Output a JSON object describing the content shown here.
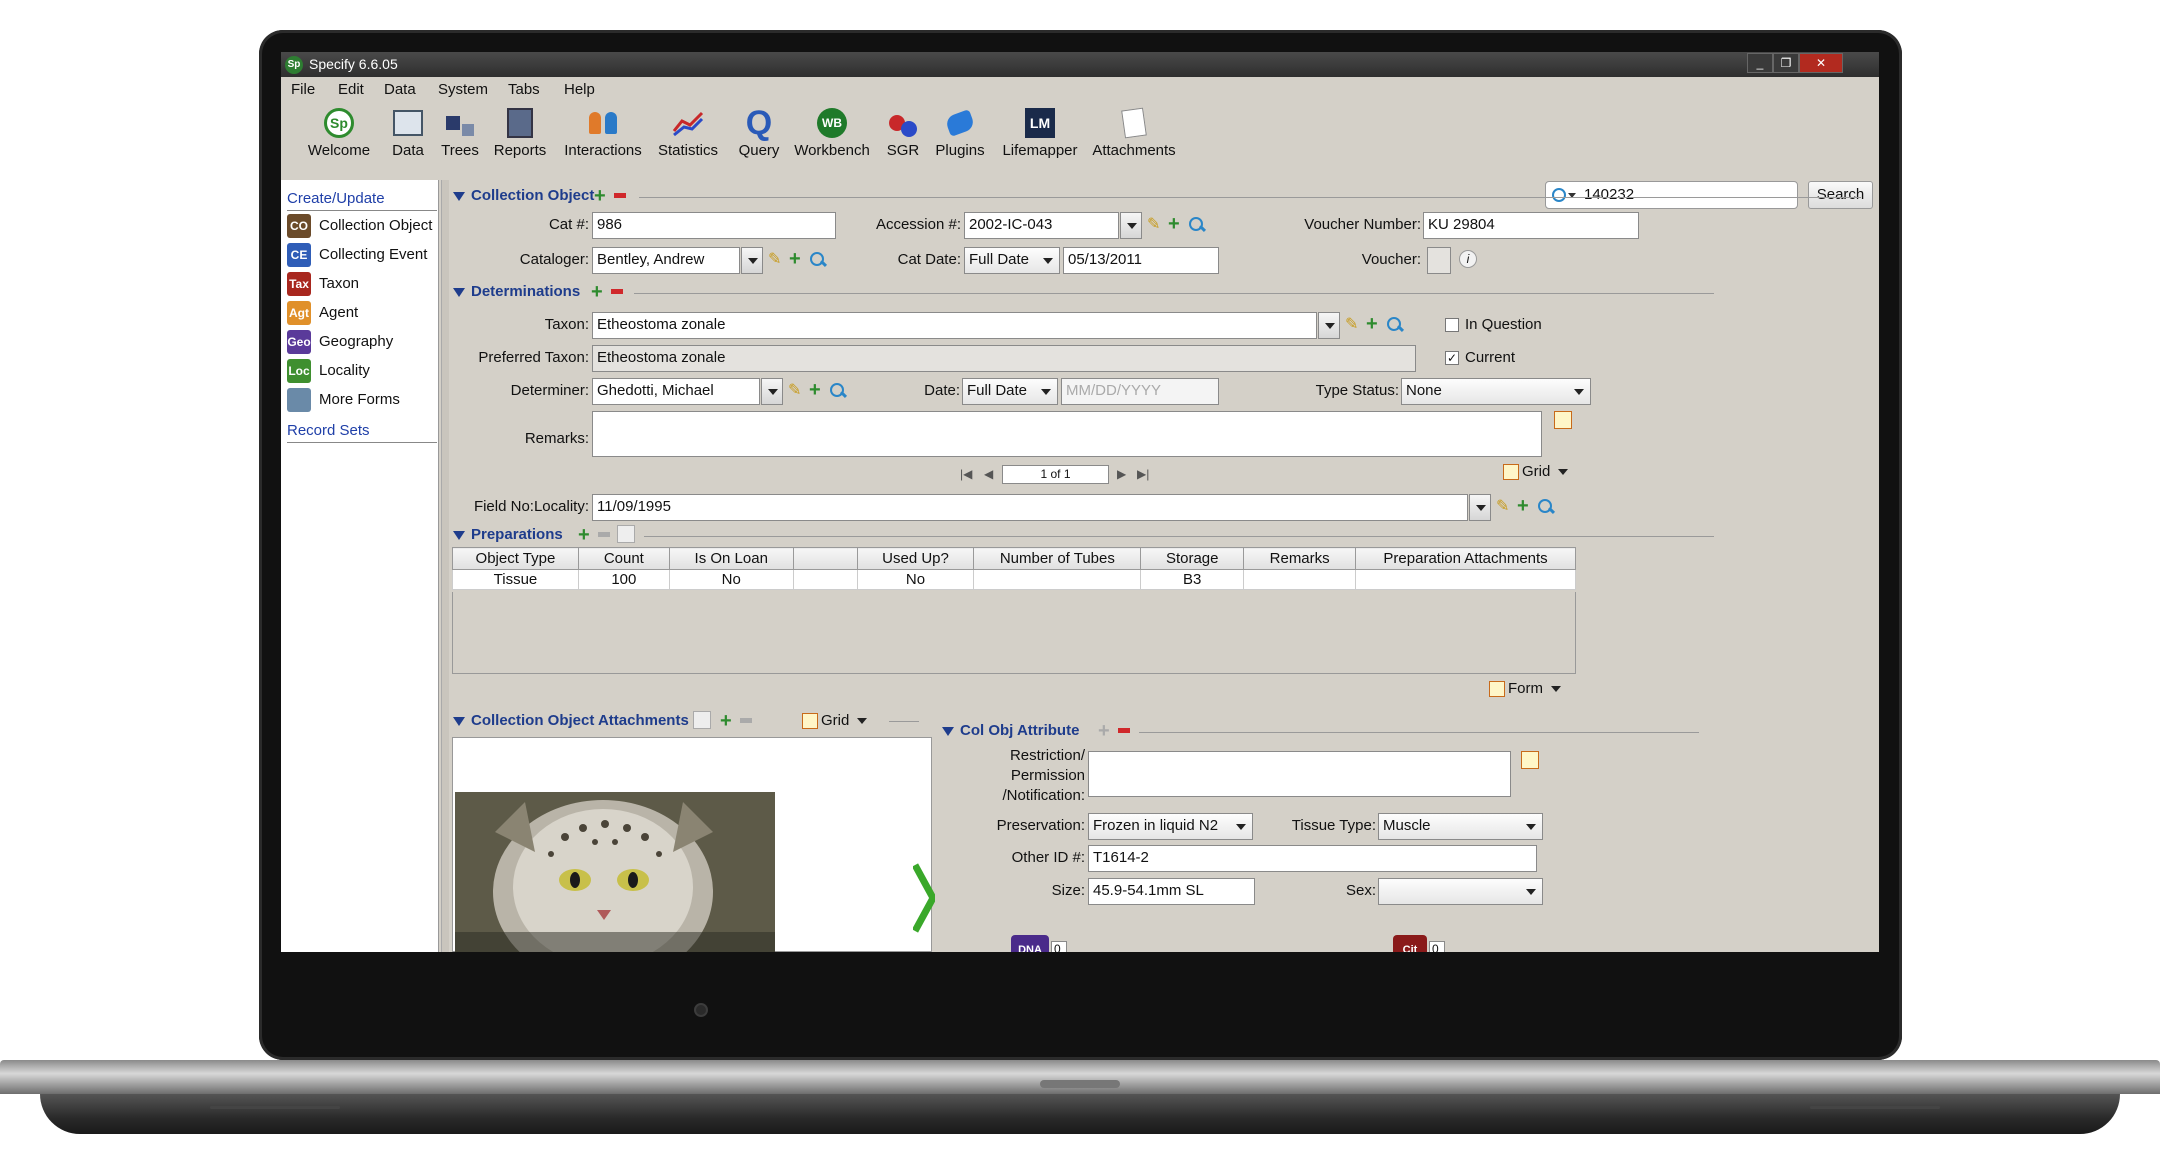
{
  "window": {
    "title": "Specify 6.6.05",
    "icon": "Sp"
  },
  "menu": [
    "File",
    "Edit",
    "Data",
    "System",
    "Tabs",
    "Help"
  ],
  "toolbar": {
    "items": [
      "Welcome",
      "Data",
      "Trees",
      "Reports",
      "Interactions",
      "Statistics",
      "Query",
      "Workbench",
      "SGR",
      "Plugins",
      "Lifemapper",
      "Attachments"
    ],
    "search_value": "140232",
    "search_button": "Search"
  },
  "sidebar": {
    "create_update": "Create/Update",
    "items": [
      {
        "abbr": "CO",
        "label": "Collection Object",
        "color": "#6b4b2a"
      },
      {
        "abbr": "CE",
        "label": "Collecting Event",
        "color": "#2f5db7"
      },
      {
        "abbr": "Tax",
        "label": "Taxon",
        "color": "#a8271e"
      },
      {
        "abbr": "Agt",
        "label": "Agent",
        "color": "#e0902a"
      },
      {
        "abbr": "Geo",
        "label": "Geography",
        "color": "#5a3a9a"
      },
      {
        "abbr": "Loc",
        "label": "Locality",
        "color": "#3f8f2f"
      },
      {
        "abbr": "",
        "label": "More Forms",
        "color": "#6a8aa8"
      }
    ],
    "record_sets": "Record Sets"
  },
  "collection_object": {
    "header": "Collection Object",
    "cat_label": "Cat #:",
    "cat_value": "986",
    "accession_label": "Accession #:",
    "accession_value": "2002-IC-043",
    "voucher_number_label": "Voucher Number:",
    "voucher_number_value": "KU 29804",
    "cataloger_label": "Cataloger:",
    "cataloger_value": "Bentley, Andrew",
    "cat_date_label": "Cat Date:",
    "cat_date_type": "Full Date",
    "cat_date_value": "05/13/2011",
    "voucher_label": "Voucher:"
  },
  "determinations": {
    "header": "Determinations",
    "taxon_label": "Taxon:",
    "taxon_value": "Etheostoma zonale",
    "preferred_taxon_label": "Preferred Taxon:",
    "preferred_taxon_value": "Etheostoma zonale",
    "in_question_label": "In Question",
    "in_question_checked": false,
    "current_label": "Current",
    "current_checked": true,
    "determiner_label": "Determiner:",
    "determiner_value": "Ghedotti, Michael",
    "date_label": "Date:",
    "date_type": "Full Date",
    "date_placeholder": "MM/DD/YYYY",
    "type_status_label": "Type Status:",
    "type_status_value": "None",
    "remarks_label": "Remarks:",
    "pager": "1 of 1",
    "grid_label": "Grid"
  },
  "field_no": {
    "label": "Field No:Locality:",
    "value": "11/09/1995"
  },
  "preparations": {
    "header": "Preparations",
    "columns": [
      "Object Type",
      "Count",
      "Is On Loan",
      "",
      "Used Up?",
      "Number of Tubes",
      "Storage",
      "Remarks",
      "Preparation Attachments"
    ],
    "rows": [
      [
        "Tissue",
        "100",
        "No",
        "",
        "No",
        "",
        "B3",
        "",
        ""
      ]
    ],
    "form_label": "Form"
  },
  "attachments": {
    "header": "Collection Object Attachments",
    "grid_label": "Grid"
  },
  "col_obj_attribute": {
    "header": "Col Obj Attribute",
    "restriction_label": "Restriction/\nPermission\n/Notification:",
    "preservation_label": "Preservation:",
    "preservation_value": "Frozen in liquid N2",
    "tissue_type_label": "Tissue Type:",
    "tissue_type_value": "Muscle",
    "other_id_label": "Other ID #:",
    "other_id_value": "T1614-2",
    "size_label": "Size:",
    "size_value": "45.9-54.1mm SL",
    "sex_label": "Sex:",
    "sex_value": "",
    "dna_count": "0",
    "cit_count": "0"
  }
}
